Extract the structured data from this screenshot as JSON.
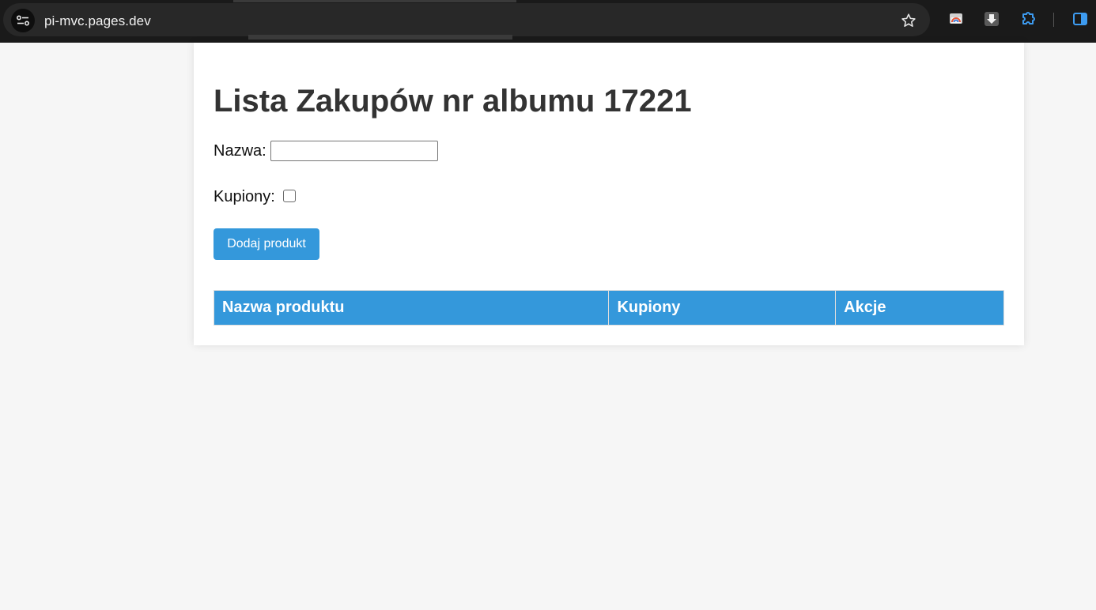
{
  "browser": {
    "url": "pi-mvc.pages.dev",
    "icons": [
      "site-info-icon",
      "bookmark-star-icon",
      "cast-icon",
      "download-icon",
      "extensions-icon",
      "side-panel-icon"
    ]
  },
  "page": {
    "title": "Lista Zakupów nr albumu 17221",
    "name_label": "Nazwa:",
    "name_value": "",
    "bought_label": "Kupiony:",
    "bought_checked": false,
    "add_button": "Dodaj produkt",
    "table": {
      "headers": [
        "Nazwa produktu",
        "Kupiony",
        "Akcje"
      ],
      "rows": []
    }
  },
  "colors": {
    "accent": "#3498db",
    "background": "#f6f6f6",
    "card": "#ffffff",
    "title": "#333333",
    "chrome": "#1a1a1a"
  }
}
